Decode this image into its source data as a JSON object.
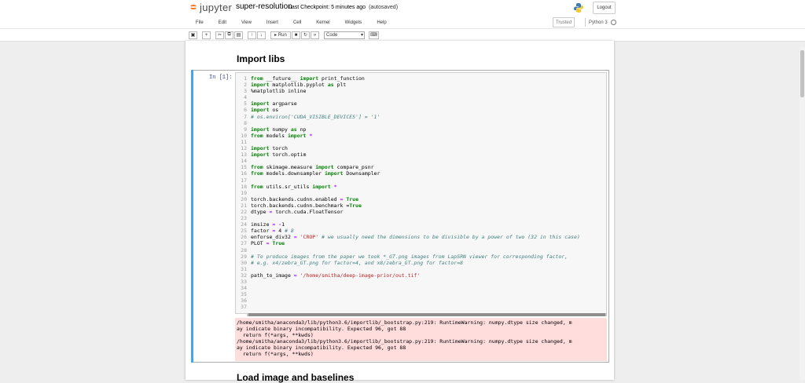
{
  "header": {
    "logo_text": "jupyter",
    "notebook_title": "super-resolution",
    "checkpoint": "Last Checkpoint: 5 minutes ago",
    "autosave": "(autosaved)",
    "logout_label": "Logout",
    "trusted_label": "Trusted",
    "kernel_name": "Python 3"
  },
  "menu": [
    "File",
    "Edit",
    "View",
    "Insert",
    "Cell",
    "Kernel",
    "Widgets",
    "Help"
  ],
  "toolbar": {
    "buttons": [
      "save-icon",
      "plus-icon",
      "cut-icon",
      "copy-icon",
      "paste-icon",
      "arrow-up-icon",
      "arrow-down-icon"
    ],
    "run_label": "Run",
    "cell_type": "Code"
  },
  "headings": [
    "Import libs",
    "Load image and baselines"
  ],
  "cell": {
    "prompt": "In [1]:",
    "line_numbers": [
      "1",
      "2",
      "3",
      "4",
      "5",
      "6",
      "7",
      "8",
      "9",
      "10",
      "11",
      "12",
      "13",
      "14",
      "15",
      "16",
      "17",
      "18",
      "19",
      "20",
      "21",
      "22",
      "23",
      "24",
      "25",
      "26",
      "27",
      "28",
      "29",
      "30",
      "31",
      "32",
      "33",
      "34",
      "35",
      "36",
      "37"
    ],
    "code_lines": [
      "from __future__ import print_function",
      "import matplotlib.pyplot as plt",
      "%matplotlib inline",
      "",
      "import argparse",
      "import os",
      "# os.environ['CUDA_VISIBLE_DEVICES'] = '1'",
      "",
      "import numpy as np",
      "from models import *",
      "",
      "import torch",
      "import torch.optim",
      "",
      "from skimage.measure import compare_psnr",
      "from models.downsampler import Downsampler",
      "",
      "from utils.sr_utils import *",
      "",
      "torch.backends.cudnn.enabled = True",
      "torch.backends.cudnn.benchmark =True",
      "dtype = torch.cuda.FloatTensor",
      "",
      "imsize = -1",
      "factor = 4 # 8",
      "enforse_div32 = 'CROP' # we usually need the dimensions to be divisible by a power of two (32 in this case)",
      "PLOT = True",
      "",
      "# To produce images from the paper we took *_GT.png images from LapSRN viewer for corresponding factor,",
      "# e.g. x4/zebra_GT.png for factor=4, and x8/zebra_GT.png for factor=8",
      "",
      "path_to_image = '/home/smitha/deep-image-prior/out.tif'",
      "",
      "",
      "",
      "",
      ""
    ],
    "stderr_lines": [
      "/home/smitha/anaconda3/lib/python3.6/importlib/_bootstrap.py:219: RuntimeWarning: numpy.dtype size changed, m",
      "ay indicate binary incompatibility. Expected 96, got 88",
      "  return f(*args, **kwds)",
      "/home/smitha/anaconda3/lib/python3.6/importlib/_bootstrap.py:219: RuntimeWarning: numpy.dtype size changed, m",
      "ay indicate binary incompatibility. Expected 96, got 88",
      "  return f(*args, **kwds)"
    ]
  },
  "colors": {
    "accent_orange": "#f37726",
    "cell_selected_bar": "#42a5f5",
    "stderr_bg": "#ffdddd",
    "keyword_green": "#008000",
    "string_red": "#ba2121",
    "comment_teal": "#408080"
  }
}
